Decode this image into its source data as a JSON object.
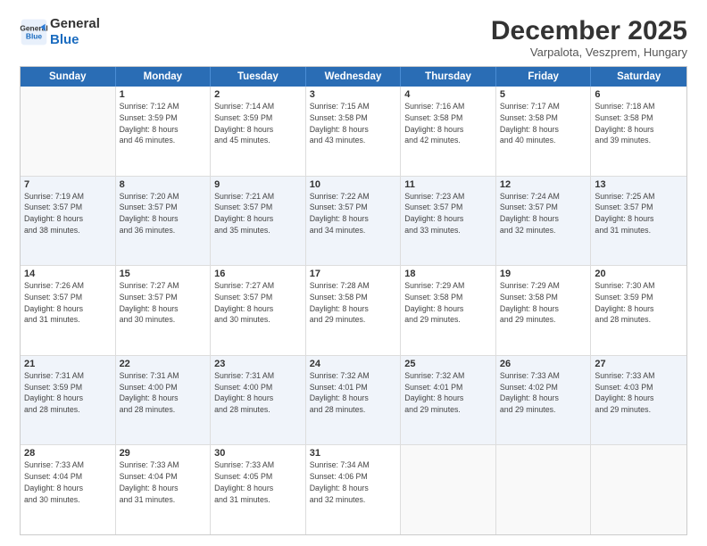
{
  "logo": {
    "line1": "General",
    "line2": "Blue"
  },
  "title": "December 2025",
  "location": "Varpalota, Veszprem, Hungary",
  "days_of_week": [
    "Sunday",
    "Monday",
    "Tuesday",
    "Wednesday",
    "Thursday",
    "Friday",
    "Saturday"
  ],
  "weeks": [
    [
      {
        "num": "",
        "info": ""
      },
      {
        "num": "1",
        "info": "Sunrise: 7:12 AM\nSunset: 3:59 PM\nDaylight: 8 hours\nand 46 minutes."
      },
      {
        "num": "2",
        "info": "Sunrise: 7:14 AM\nSunset: 3:59 PM\nDaylight: 8 hours\nand 45 minutes."
      },
      {
        "num": "3",
        "info": "Sunrise: 7:15 AM\nSunset: 3:58 PM\nDaylight: 8 hours\nand 43 minutes."
      },
      {
        "num": "4",
        "info": "Sunrise: 7:16 AM\nSunset: 3:58 PM\nDaylight: 8 hours\nand 42 minutes."
      },
      {
        "num": "5",
        "info": "Sunrise: 7:17 AM\nSunset: 3:58 PM\nDaylight: 8 hours\nand 40 minutes."
      },
      {
        "num": "6",
        "info": "Sunrise: 7:18 AM\nSunset: 3:58 PM\nDaylight: 8 hours\nand 39 minutes."
      }
    ],
    [
      {
        "num": "7",
        "info": "Sunrise: 7:19 AM\nSunset: 3:57 PM\nDaylight: 8 hours\nand 38 minutes."
      },
      {
        "num": "8",
        "info": "Sunrise: 7:20 AM\nSunset: 3:57 PM\nDaylight: 8 hours\nand 36 minutes."
      },
      {
        "num": "9",
        "info": "Sunrise: 7:21 AM\nSunset: 3:57 PM\nDaylight: 8 hours\nand 35 minutes."
      },
      {
        "num": "10",
        "info": "Sunrise: 7:22 AM\nSunset: 3:57 PM\nDaylight: 8 hours\nand 34 minutes."
      },
      {
        "num": "11",
        "info": "Sunrise: 7:23 AM\nSunset: 3:57 PM\nDaylight: 8 hours\nand 33 minutes."
      },
      {
        "num": "12",
        "info": "Sunrise: 7:24 AM\nSunset: 3:57 PM\nDaylight: 8 hours\nand 32 minutes."
      },
      {
        "num": "13",
        "info": "Sunrise: 7:25 AM\nSunset: 3:57 PM\nDaylight: 8 hours\nand 31 minutes."
      }
    ],
    [
      {
        "num": "14",
        "info": "Sunrise: 7:26 AM\nSunset: 3:57 PM\nDaylight: 8 hours\nand 31 minutes."
      },
      {
        "num": "15",
        "info": "Sunrise: 7:27 AM\nSunset: 3:57 PM\nDaylight: 8 hours\nand 30 minutes."
      },
      {
        "num": "16",
        "info": "Sunrise: 7:27 AM\nSunset: 3:57 PM\nDaylight: 8 hours\nand 30 minutes."
      },
      {
        "num": "17",
        "info": "Sunrise: 7:28 AM\nSunset: 3:58 PM\nDaylight: 8 hours\nand 29 minutes."
      },
      {
        "num": "18",
        "info": "Sunrise: 7:29 AM\nSunset: 3:58 PM\nDaylight: 8 hours\nand 29 minutes."
      },
      {
        "num": "19",
        "info": "Sunrise: 7:29 AM\nSunset: 3:58 PM\nDaylight: 8 hours\nand 29 minutes."
      },
      {
        "num": "20",
        "info": "Sunrise: 7:30 AM\nSunset: 3:59 PM\nDaylight: 8 hours\nand 28 minutes."
      }
    ],
    [
      {
        "num": "21",
        "info": "Sunrise: 7:31 AM\nSunset: 3:59 PM\nDaylight: 8 hours\nand 28 minutes."
      },
      {
        "num": "22",
        "info": "Sunrise: 7:31 AM\nSunset: 4:00 PM\nDaylight: 8 hours\nand 28 minutes."
      },
      {
        "num": "23",
        "info": "Sunrise: 7:31 AM\nSunset: 4:00 PM\nDaylight: 8 hours\nand 28 minutes."
      },
      {
        "num": "24",
        "info": "Sunrise: 7:32 AM\nSunset: 4:01 PM\nDaylight: 8 hours\nand 28 minutes."
      },
      {
        "num": "25",
        "info": "Sunrise: 7:32 AM\nSunset: 4:01 PM\nDaylight: 8 hours\nand 29 minutes."
      },
      {
        "num": "26",
        "info": "Sunrise: 7:33 AM\nSunset: 4:02 PM\nDaylight: 8 hours\nand 29 minutes."
      },
      {
        "num": "27",
        "info": "Sunrise: 7:33 AM\nSunset: 4:03 PM\nDaylight: 8 hours\nand 29 minutes."
      }
    ],
    [
      {
        "num": "28",
        "info": "Sunrise: 7:33 AM\nSunset: 4:04 PM\nDaylight: 8 hours\nand 30 minutes."
      },
      {
        "num": "29",
        "info": "Sunrise: 7:33 AM\nSunset: 4:04 PM\nDaylight: 8 hours\nand 31 minutes."
      },
      {
        "num": "30",
        "info": "Sunrise: 7:33 AM\nSunset: 4:05 PM\nDaylight: 8 hours\nand 31 minutes."
      },
      {
        "num": "31",
        "info": "Sunrise: 7:34 AM\nSunset: 4:06 PM\nDaylight: 8 hours\nand 32 minutes."
      },
      {
        "num": "",
        "info": ""
      },
      {
        "num": "",
        "info": ""
      },
      {
        "num": "",
        "info": ""
      }
    ]
  ]
}
